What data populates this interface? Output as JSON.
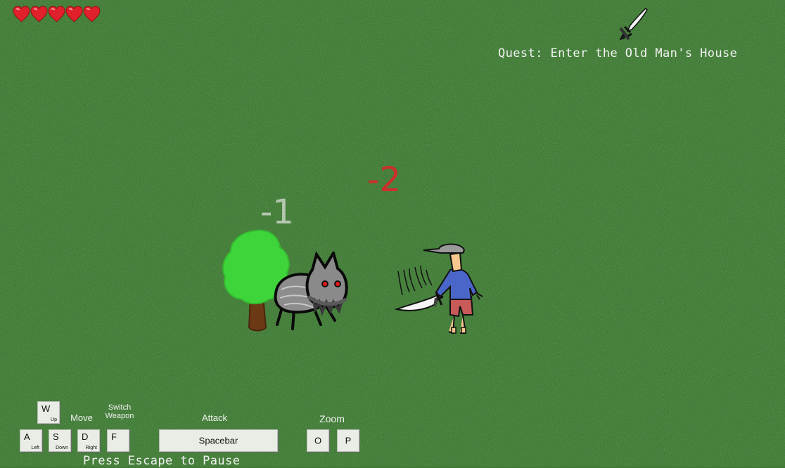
{
  "hud": {
    "health_hearts": 5,
    "weapon_icon": "sword-icon",
    "quest_text": "Quest: Enter the Old Man's House"
  },
  "damage_numbers": {
    "enemy": "-1",
    "player": "-2"
  },
  "sprites": {
    "tree": "tree-sprite",
    "enemy": "wolf-creature-sprite",
    "player": "player-with-sword-sprite"
  },
  "controls": {
    "move_label": "Move",
    "switch_weapon_label": "Switch\nWeapon",
    "attack_label": "Attack",
    "zoom_label": "Zoom",
    "keys": {
      "w": {
        "main": "W",
        "sub": "Up"
      },
      "a": {
        "main": "A",
        "sub": "Left"
      },
      "s": {
        "main": "S",
        "sub": "Down"
      },
      "d": {
        "main": "D",
        "sub": "Right"
      },
      "f": {
        "main": "F"
      },
      "spacebar": {
        "main": "Spacebar"
      },
      "o": {
        "main": "O"
      },
      "p": {
        "main": "P"
      }
    },
    "pause_text": "Press Escape to Pause"
  },
  "colors": {
    "grass": "#3f7a35",
    "heart": "#e0202a",
    "damage_player": "#d42a2a",
    "hud_text": "#f2f2f2"
  }
}
